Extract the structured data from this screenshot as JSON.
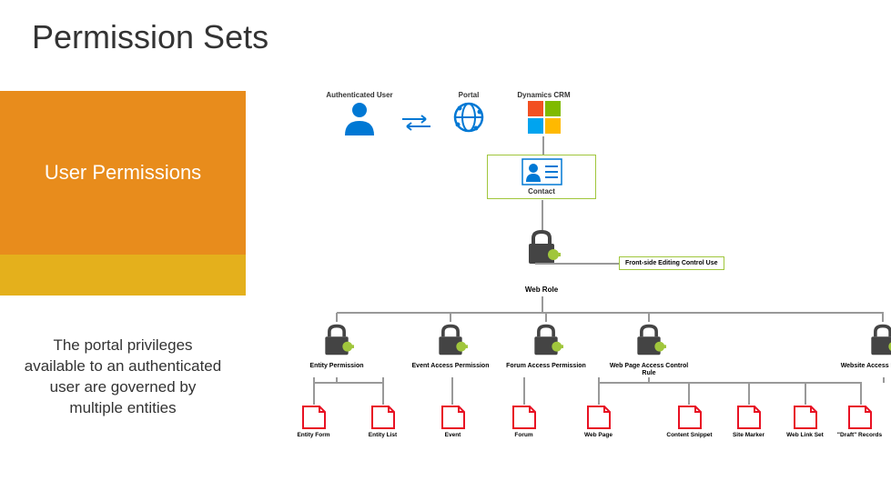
{
  "title": "Permission Sets",
  "subtitle": "User Permissions",
  "description": "The portal privileges available to an authenticated user are governed by multiple entities",
  "top": {
    "auth_user": "Authenticated User",
    "portal": "Portal",
    "crm": "Dynamics CRM"
  },
  "contact": "Contact",
  "web_role": "Web Role",
  "front_side": "Front-side Editing Control Use",
  "permissions": {
    "entity": "Entity Permission",
    "event": "Event Access Permission",
    "forum": "Forum Access Permission",
    "webpage": "Web Page Access Control Rule",
    "website": "Website Access Permission"
  },
  "docs": {
    "entity_form": "Entity Form",
    "entity_list": "Entity List",
    "event": "Event",
    "forum": "Forum",
    "web_page": "Web Page",
    "content_snippet": "Content Snippet",
    "site_marker": "Site Marker",
    "web_link_set": "Web Link Set",
    "draft_records": "\"Draft\" Records"
  },
  "icons": {
    "person": "person-icon",
    "globe": "globe-icon",
    "ms": "microsoft-logo",
    "contact_card": "contact-card-icon",
    "lock": "lock-key-icon",
    "doc": "document-icon"
  }
}
